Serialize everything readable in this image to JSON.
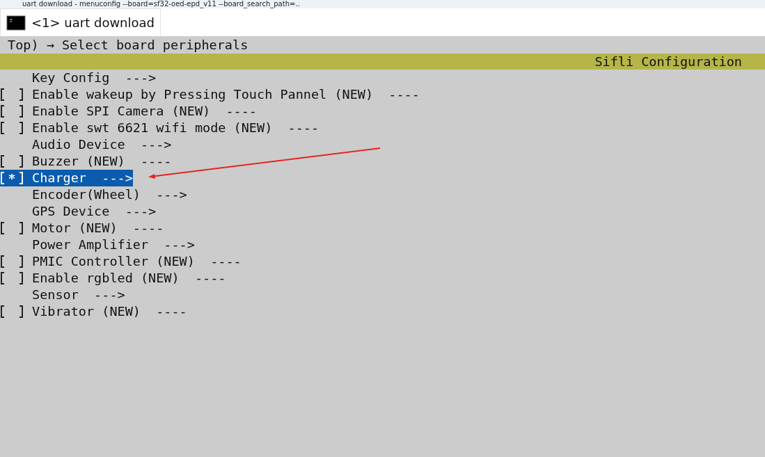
{
  "window": {
    "title": "uart download - menuconfig --board=sf32-oed-epd_v11 --board_search_path=.."
  },
  "tabs": [
    {
      "label": "<1> uart download",
      "selected": true
    }
  ],
  "breadcrumb": "Top) → Select board peripherals",
  "header": {
    "title": "Sifli Configuration"
  },
  "items": [
    {
      "kind": "menu",
      "label": "Key Config  --->",
      "selected": false
    },
    {
      "kind": "checkbox",
      "label": "Enable wakeup by Pressing Touch Pannel (NEW)  ----",
      "checked": false,
      "selected": false
    },
    {
      "kind": "checkbox",
      "label": "Enable SPI Camera (NEW)  ----",
      "checked": false,
      "selected": false
    },
    {
      "kind": "checkbox",
      "label": "Enable swt 6621 wifi mode (NEW)  ----",
      "checked": false,
      "selected": false
    },
    {
      "kind": "menu",
      "label": "Audio Device  --->",
      "selected": false
    },
    {
      "kind": "checkbox",
      "label": "Buzzer (NEW)  ----",
      "checked": false,
      "selected": false
    },
    {
      "kind": "checkbox",
      "label": "Charger  --->",
      "checked": true,
      "selected": true
    },
    {
      "kind": "menu",
      "label": "Encoder(Wheel)  --->",
      "selected": false
    },
    {
      "kind": "menu",
      "label": "GPS Device  --->",
      "selected": false
    },
    {
      "kind": "checkbox",
      "label": "Motor (NEW)  ----",
      "checked": false,
      "selected": false
    },
    {
      "kind": "menu",
      "label": "Power Amplifier  --->",
      "selected": false
    },
    {
      "kind": "checkbox",
      "label": "PMIC Controller (NEW)  ----",
      "checked": false,
      "selected": false
    },
    {
      "kind": "checkbox",
      "label": "Enable rgbled (NEW)  ----",
      "checked": false,
      "selected": false
    },
    {
      "kind": "menu",
      "label": "Sensor  --->",
      "selected": false
    },
    {
      "kind": "checkbox",
      "label": "Vibrator (NEW)  ----",
      "checked": false,
      "selected": false
    }
  ]
}
